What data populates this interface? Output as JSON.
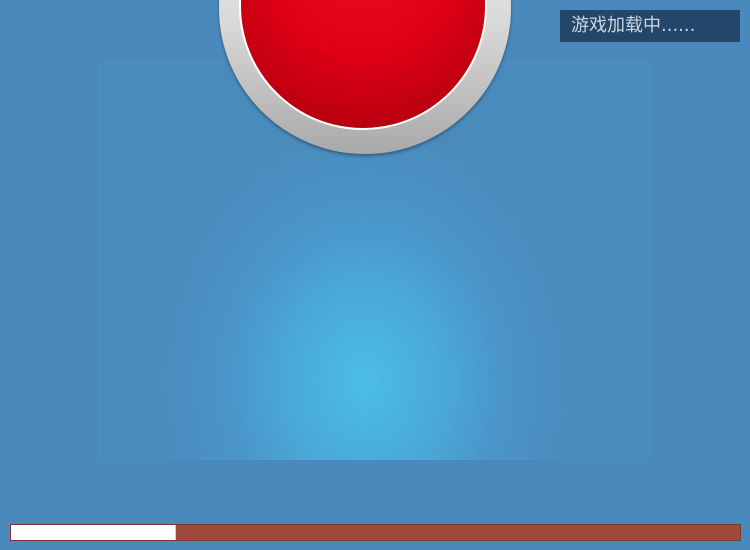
{
  "loading": {
    "text": "游戏加载中......"
  },
  "progress": {
    "percent": 22.6
  },
  "colors": {
    "background": "#4a89bb",
    "panel_glow": "#4bbde6",
    "button_red": "#e00015",
    "button_ring": "#d9d9d9",
    "label_bg": "#24466a",
    "progress_track": "#9d4a3c",
    "progress_fill": "#ffffff"
  },
  "icons": {
    "button": "red-round-button"
  }
}
